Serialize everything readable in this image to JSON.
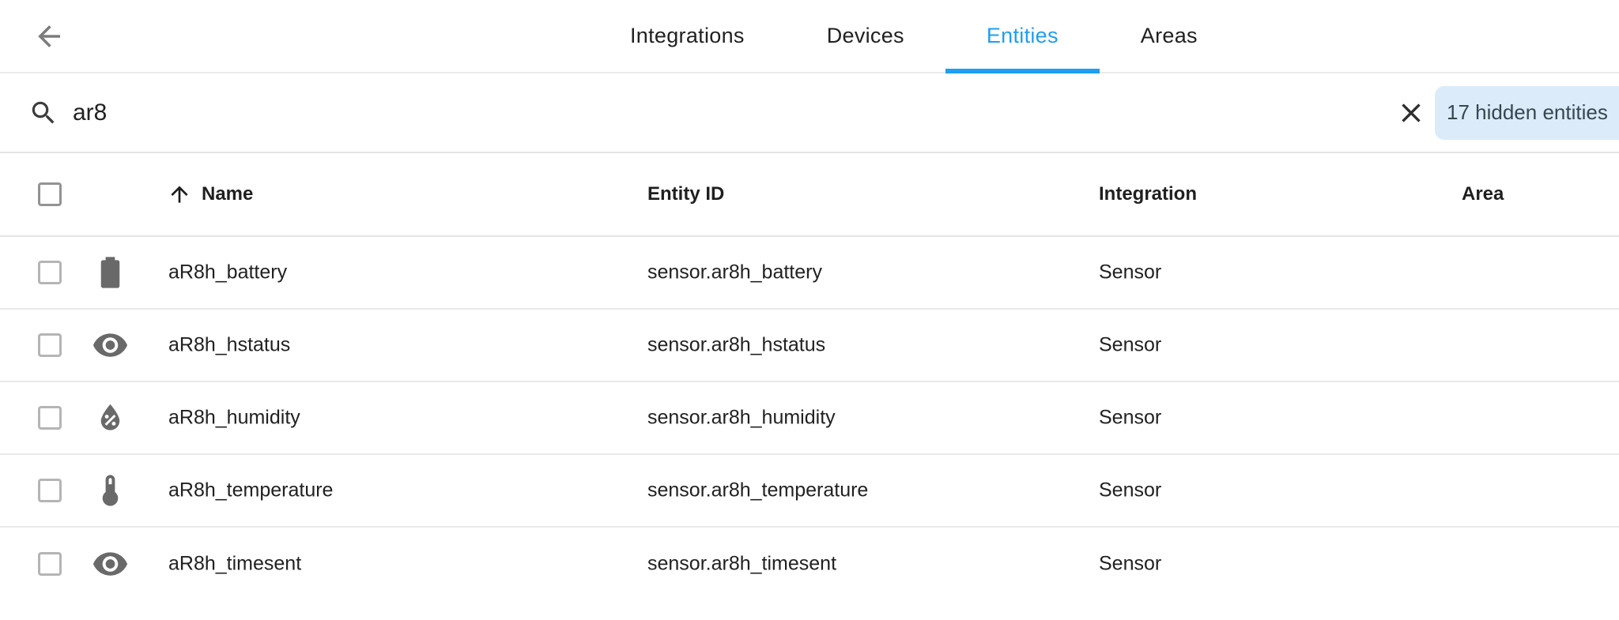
{
  "colors": {
    "accent": "#1e9ff2",
    "chip_bg": "#dcebfa",
    "chip_text": "#37474f"
  },
  "header": {
    "back_icon": "arrow-left-icon",
    "tabs": [
      {
        "label": "Integrations",
        "active": false
      },
      {
        "label": "Devices",
        "active": false
      },
      {
        "label": "Entities",
        "active": true
      },
      {
        "label": "Areas",
        "active": false
      }
    ]
  },
  "search": {
    "icon": "search-icon",
    "value": "ar8",
    "placeholder": "",
    "clear_icon": "close-icon",
    "hidden_chip_label": "17 hidden entities"
  },
  "table": {
    "sort_icon": "arrow-up-icon",
    "sort_column": "Name",
    "sort_direction": "ascending",
    "columns": {
      "name": "Name",
      "entity_id": "Entity ID",
      "integration": "Integration",
      "area": "Area"
    },
    "rows": [
      {
        "icon": "battery",
        "name": "aR8h_battery",
        "entity_id": "sensor.ar8h_battery",
        "integration": "Sensor",
        "area": ""
      },
      {
        "icon": "eye",
        "name": "aR8h_hstatus",
        "entity_id": "sensor.ar8h_hstatus",
        "integration": "Sensor",
        "area": ""
      },
      {
        "icon": "water-percent",
        "name": "aR8h_humidity",
        "entity_id": "sensor.ar8h_humidity",
        "integration": "Sensor",
        "area": ""
      },
      {
        "icon": "thermometer",
        "name": "aR8h_temperature",
        "entity_id": "sensor.ar8h_temperature",
        "integration": "Sensor",
        "area": ""
      },
      {
        "icon": "eye",
        "name": "aR8h_timesent",
        "entity_id": "sensor.ar8h_timesent",
        "integration": "Sensor",
        "area": ""
      }
    ]
  }
}
